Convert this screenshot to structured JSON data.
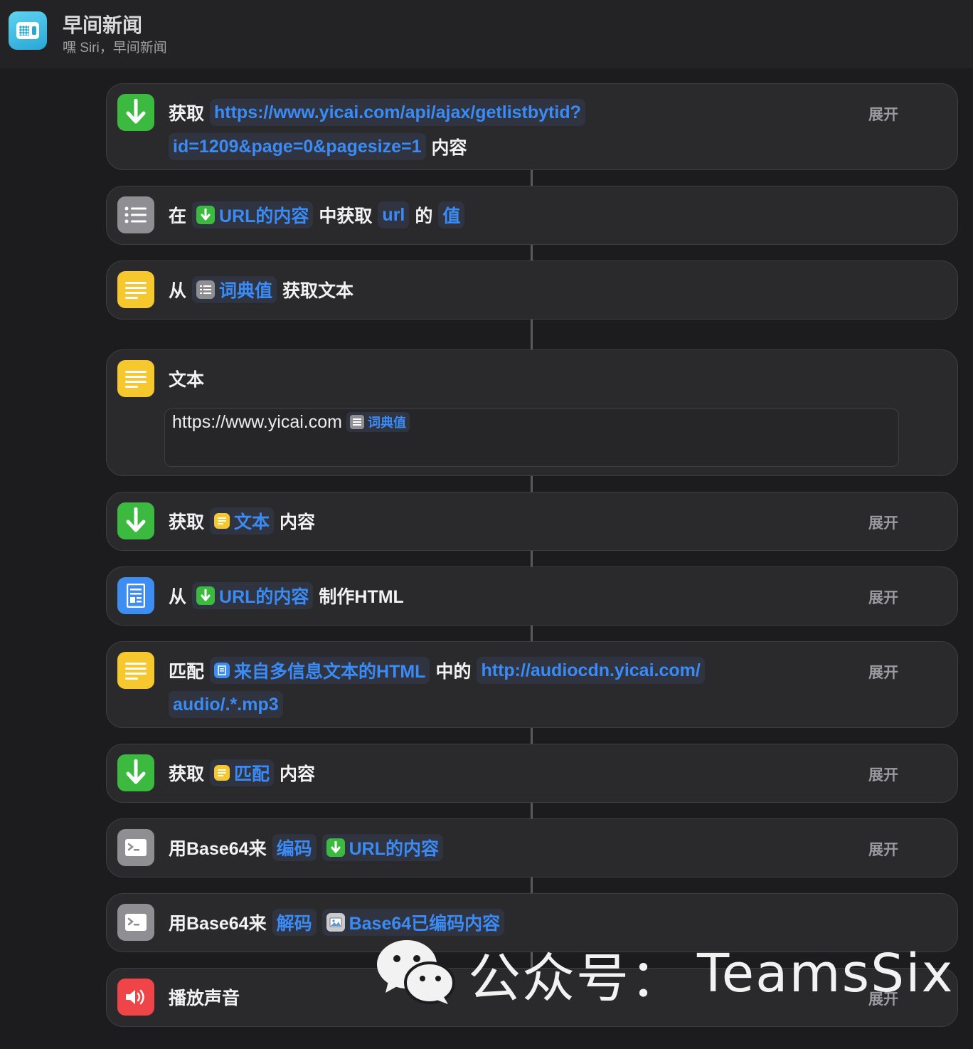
{
  "header": {
    "title": "早间新闻",
    "subtitle": "嘿 Siri，早间新闻",
    "icon": "radio-app-icon"
  },
  "colors": {
    "background": "#1c1c1e",
    "card": "#2a2a2c",
    "accent_blue": "#3a8bf5",
    "green": "#3cba3f",
    "yellow": "#f6c82e",
    "gray": "#8e8e93",
    "blue": "#3d8ef0",
    "red": "#ef4448"
  },
  "actions": [
    {
      "icon": "download-arrow-icon",
      "verb": "获取",
      "url_line1": "https://www.yicai.com/api/ajax/getlistbytid?",
      "url_line2": "id=1209&page=0&pagesize=1",
      "suffix": "内容",
      "expand": "展开"
    },
    {
      "icon": "list-icon",
      "prefix": "在",
      "source": "URL的内容",
      "mid": "中获取",
      "key": "url",
      "of": "的",
      "value": "值"
    },
    {
      "icon": "text-lines-icon",
      "prefix": "从",
      "source": "词典值",
      "suffix": "获取文本"
    },
    {
      "icon": "text-lines-icon",
      "title": "文本",
      "content_text": "https://www.yicai.com",
      "content_var": "词典值"
    },
    {
      "icon": "download-arrow-icon",
      "verb": "获取",
      "source": "文本",
      "suffix": "内容",
      "expand": "展开"
    },
    {
      "icon": "document-icon",
      "prefix": "从",
      "source": "URL的内容",
      "suffix": "制作HTML",
      "expand": "展开"
    },
    {
      "icon": "text-lines-icon",
      "verb": "匹配",
      "source": "来自多信息文本的HTML",
      "mid": "中的",
      "pattern_line1": "http://audiocdn.yicai.com/",
      "pattern_line2": "audio/.*.mp3",
      "expand": "展开"
    },
    {
      "icon": "download-arrow-icon",
      "verb": "获取",
      "source": "匹配",
      "suffix": "内容",
      "expand": "展开"
    },
    {
      "icon": "terminal-icon",
      "verb": "用Base64来",
      "mode": "编码",
      "source": "URL的内容",
      "expand": "展开"
    },
    {
      "icon": "terminal-icon",
      "verb": "用Base64来",
      "mode": "解码",
      "source": "Base64已编码内容"
    },
    {
      "icon": "speaker-icon",
      "verb": "播放声音",
      "expand": "展开"
    }
  ],
  "watermark": {
    "label": "公众号：",
    "name": "TeamsSix",
    "icon": "wechat-icon"
  }
}
